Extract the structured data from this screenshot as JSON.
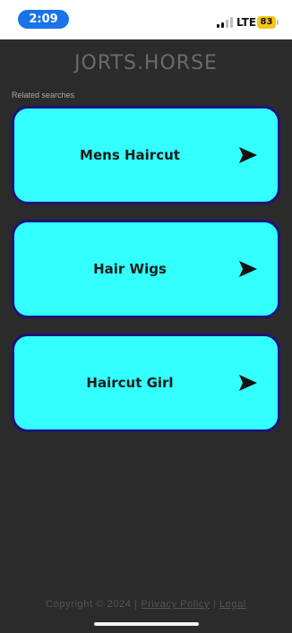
{
  "status_bar": {
    "time": "2:09",
    "network": "LTE",
    "battery": "83",
    "signal_bars_filled": 2,
    "signal_bars_total": 4,
    "colors": {
      "time_pill": "#1a73e8",
      "battery": "#f5c518"
    }
  },
  "header": {
    "site_title": "JORTS.HORSE"
  },
  "related": {
    "label": "Related searches",
    "items": [
      {
        "label": "Mens Haircut",
        "icon": "arrow-right-icon"
      },
      {
        "label": "Hair Wigs",
        "icon": "arrow-right-icon"
      },
      {
        "label": "Haircut Girl",
        "icon": "arrow-right-icon"
      }
    ],
    "colors": {
      "card_bg": "#33ffff",
      "card_border": "#1d137a"
    }
  },
  "footer": {
    "copyright": "Copyright © 2024 |",
    "privacy_link": "Privacy Policy",
    "separator": "|",
    "legal_link": "Legal"
  },
  "theme": {
    "page_bg": "#2b2b2b"
  }
}
